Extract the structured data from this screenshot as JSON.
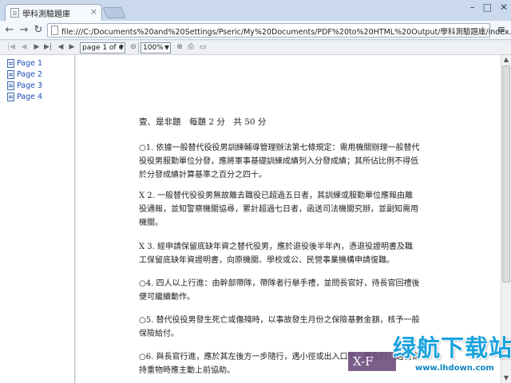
{
  "browser": {
    "tab_title": "學科測驗題庫",
    "tab_close": "×",
    "url": "file:///C:/Documents%20and%20Settings/Pseric/My%20Documents/PDF%20to%20HTML%20Output/學科測驗題庫/index.htm",
    "back_icon": "←",
    "forward_icon": "→",
    "reload_icon": "↻",
    "star_icon": "☆",
    "wrench_icon": "🔧",
    "minimize": "–",
    "maximize": "□",
    "close": "✕"
  },
  "pdf_toolbar": {
    "first_icon": "|◀",
    "prev_icon": "◀",
    "next_icon": "▶",
    "last_icon": "▶|",
    "back_icon": "◆",
    "forward_icon": "◆",
    "page_select": "page 1 of 4",
    "zoom_out_icon": "⊖",
    "zoom_select": "100%",
    "zoom_in_icon": "⊕",
    "print_icon": "⎙",
    "fullscreen_icon": "▭"
  },
  "sidebar": {
    "items": [
      "Page 1",
      "Page 2",
      "Page 3",
      "Page 4"
    ]
  },
  "document": {
    "heading": "壹、是非題　每題 2 分　共 50 分",
    "questions": [
      "○1.  依據一般替代役役男訓練輔導管理辦法第七條規定：需用機關辦理一般替代役役男服勤單位分發，應將軍事基礎訓練成績列入分發成績；其所佔比例不得低於分發成績計算基準之百分之四十。",
      "X 2.   一般替代役役男無故離去職役已超過五日者，其訓練或服勤單位應報由離役通報，並知警察機關協尋，累計超過七日者，函送司法機關究辦，並副知需用機關。",
      "X 3.   經申請保留底缺年資之替代役男，應於退役後半年內，憑退役證明書及職工保留底缺年資證明書，向原機關、學校或公、民營事業機構申請復職。",
      "○4.  四人以上行進：由幹部帶隊，帶隊者行舉手禮，並問長官好，待長官回禮後便可繼續動作。",
      "○5.  替代役役男發生死亡或傷殘時，以事故發生月份之保險基數金額，核予一般保險給付。",
      "○6.  與長官行進，應於其左後方一步隨行，遇小徑或出入口時，應先行；遇長官持重物時應主動上前協助。"
    ]
  },
  "watermark": {
    "band_text": "X-F",
    "logo_text": "绿航下载站",
    "url_text": "www.lhdown.com"
  }
}
